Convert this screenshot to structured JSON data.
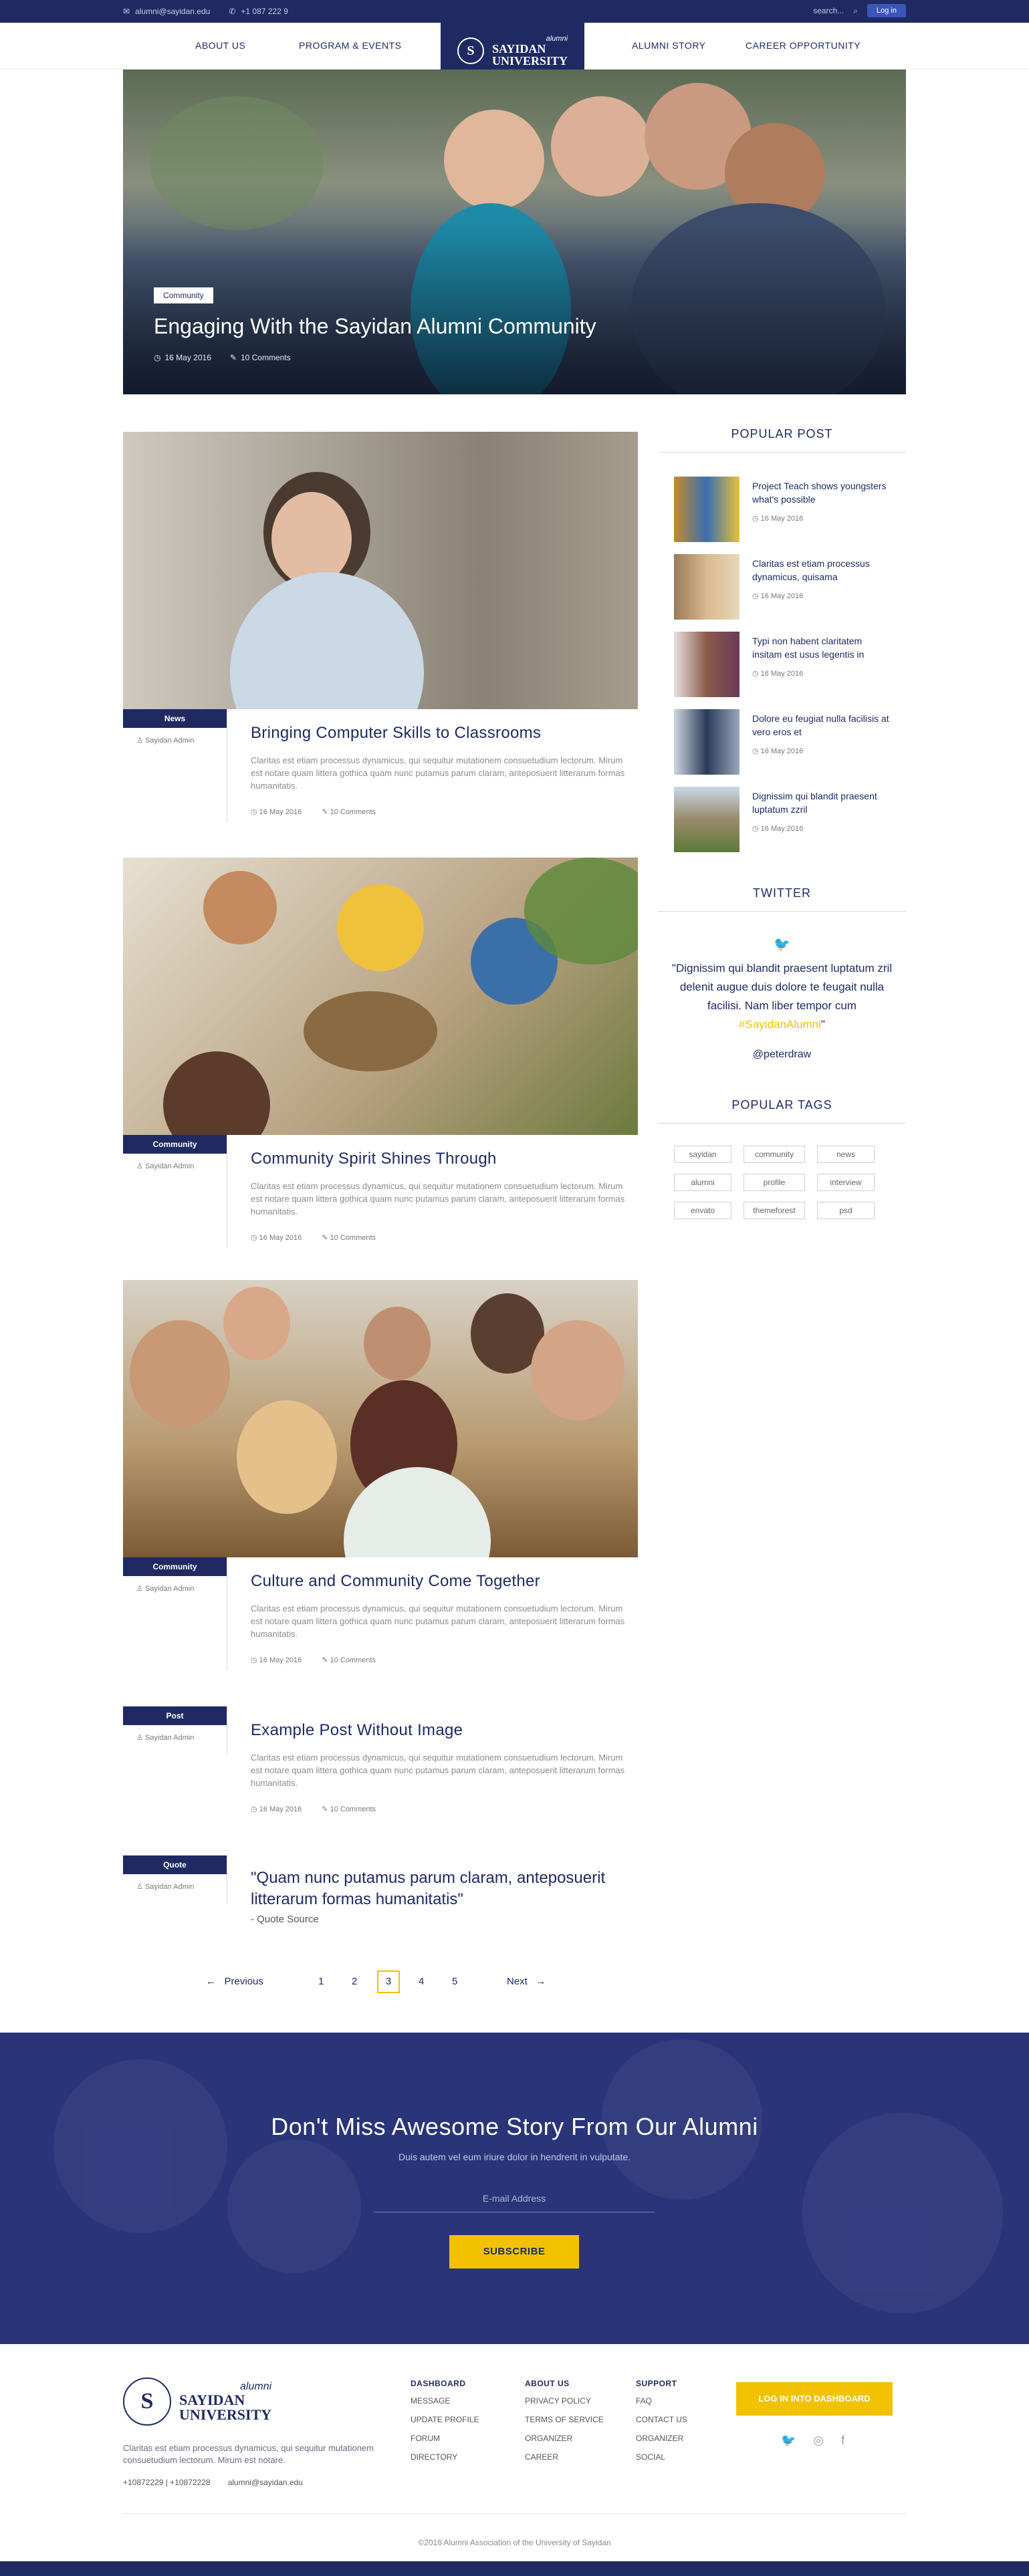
{
  "topbar": {
    "email": "alumni@sayidan.edu",
    "phone": "+1 087 222 9",
    "search_placeholder": "search...",
    "login": "Log in"
  },
  "nav": {
    "left": [
      "ABOUT US",
      "PROGRAM & EVENTS"
    ],
    "right": [
      "ALUMNI STORY",
      "CAREER OPPORTUNITY"
    ],
    "logo_script": "alumni",
    "logo_name_1": "SAYIDAN",
    "logo_name_2": "UNIVERSITY"
  },
  "hero": {
    "tag": "Community",
    "title": "Engaging With the Sayidan Alumni Community",
    "date": "16 May 2016",
    "comments": "10 Comments"
  },
  "posts": [
    {
      "category": "News",
      "author": "Sayidan Admin",
      "title": "Bringing Computer Skills to Classrooms",
      "excerpt": "Claritas est etiam processus dynamicus, qui sequitur mutationem consuetudium lectorum. Mirum est notare quam littera gothica quam nunc putamus parum claram, anteposuerit litterarum formas humanitatis.",
      "date": "16 May 2016",
      "comments": "10 Comments"
    },
    {
      "category": "Community",
      "author": "Sayidan Admin",
      "title": "Community Spirit Shines Through",
      "excerpt": "Claritas est etiam processus dynamicus, qui sequitur mutationem consuetudium lectorum. Mirum est notare quam littera gothica quam nunc putamus parum claram, anteposuerit litterarum formas humanitatis.",
      "date": "16 May 2016",
      "comments": "10 Comments"
    },
    {
      "category": "Community",
      "author": "Sayidan Admin",
      "title": "Culture and Community Come Together",
      "excerpt": "Claritas est etiam processus dynamicus, qui sequitur mutationem consuetudium lectorum. Mirum est notare quam littera gothica quam nunc putamus parum claram, anteposuerit litterarum formas humanitatis.",
      "date": "16 May 2016",
      "comments": "10 Comments"
    },
    {
      "category": "Post",
      "author": "Sayidan Admin",
      "title": "Example Post Without Image",
      "excerpt": "Claritas est etiam processus dynamicus, qui sequitur mutationem consuetudium lectorum. Mirum est notare quam littera gothica quam nunc putamus parum claram, anteposuerit litterarum formas humanitatis.",
      "date": "16 May 2016",
      "comments": "10 Comments"
    },
    {
      "category": "Quote",
      "author": "Sayidan Admin",
      "quote": "\"Quam nunc putamus parum claram, anteposuerit litterarum formas humanitatis\"",
      "source": "- Quote Source"
    }
  ],
  "popular": {
    "heading": "POPULAR POST",
    "items": [
      {
        "title": "Project Teach shows youngsters what's possible",
        "date": "16 May 2016"
      },
      {
        "title": "Claritas est etiam processus dynamicus, quisama",
        "date": "16 May 2016"
      },
      {
        "title": "Typi non habent claritatem insitam est usus legentis in",
        "date": "16 May 2016"
      },
      {
        "title": "Dolore eu feugiat nulla facilisis at vero eros et",
        "date": "16 May 2016"
      },
      {
        "title": "Dignissim qui blandit praesent luptatum zzril",
        "date": "16 May 2016"
      }
    ]
  },
  "twitter": {
    "heading": "TWITTER",
    "text": "\"Dignissim qui blandit praesent luptatum zril delenit augue duis dolore te feugait nulla facilisi. Nam liber tempor cum ",
    "hashtag": "#SayidanAlumni",
    "text_end": "\"",
    "handle": "@peterdraw"
  },
  "tags": {
    "heading": "POPULAR TAGS",
    "items": [
      "sayidan",
      "community",
      "news",
      "alumni",
      "profile",
      "interview",
      "envato",
      "themeforest",
      "psd"
    ]
  },
  "pagination": {
    "prev": "Previous",
    "pages": [
      "1",
      "2",
      "3",
      "4",
      "5"
    ],
    "current": "3",
    "next": "Next"
  },
  "newsletter": {
    "title": "Don't Miss Awesome Story From Our Alumni",
    "subtitle": "Duis autem vel eum iriure dolor in hendrerit in vulputate.",
    "placeholder": "E-mail Address",
    "button": "SUBSCRIBE"
  },
  "footer": {
    "logo_script": "alumni",
    "logo_name_1": "SAYIDAN",
    "logo_name_2": "UNIVERSITY",
    "description": "Claritas est etiam processus dynamicus, qui sequitur mutationem consuetudium lectorum. Mirum est notare.",
    "phone": "+10872229 | +10872228",
    "email": "alumni@sayidan.edu",
    "columns": [
      {
        "heading": "DASHBOARD",
        "links": [
          "MESSAGE",
          "UPDATE PROFILE",
          "FORUM",
          "DIRECTORY"
        ]
      },
      {
        "heading": "ABOUT US",
        "links": [
          "PRIVACY POLICY",
          "TERMS OF SERVICE",
          "ORGANIZER",
          "CAREER"
        ]
      },
      {
        "heading": "SUPPORT",
        "links": [
          "FAQ",
          "CONTACT US",
          "ORGANIZER",
          "SOCIAL"
        ]
      }
    ],
    "cta": "LOG IN INTO DASHBOARD",
    "copyright": "©2016 Alumni Association of the University of Sayidan"
  },
  "colors": {
    "navy": "#1f2a63",
    "accent": "#f2c200",
    "login": "#3a56b8"
  }
}
